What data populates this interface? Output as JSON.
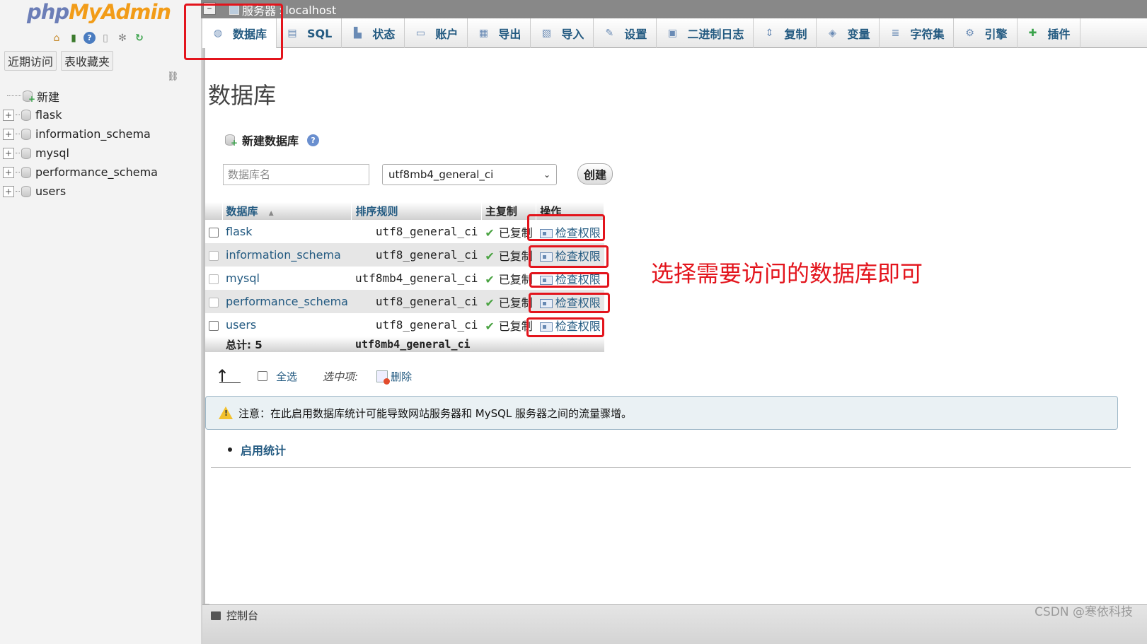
{
  "app": {
    "logo_php": "php",
    "logo_myadmin": "MyAdmin"
  },
  "colors": {
    "link": "#235a81",
    "annotation_red": "#e3141c",
    "logo_php": "#6c7eb7",
    "logo_myadmin": "#f29c18"
  },
  "sidebar": {
    "quick_icons": [
      "home-icon",
      "exit-icon",
      "help-icon",
      "docs-icon",
      "settings-icon",
      "reload-icon"
    ],
    "tabs": [
      "近期访问",
      "表收藏夹"
    ],
    "tree": [
      {
        "label": "新建",
        "icon": "new-database-icon",
        "expandable": false
      },
      {
        "label": "flask",
        "icon": "database-icon",
        "expandable": true
      },
      {
        "label": "information_schema",
        "icon": "database-icon",
        "expandable": true
      },
      {
        "label": "mysql",
        "icon": "database-icon",
        "expandable": true
      },
      {
        "label": "performance_schema",
        "icon": "database-icon",
        "expandable": true
      },
      {
        "label": "users",
        "icon": "database-icon",
        "expandable": true
      }
    ]
  },
  "topbar": {
    "server_label": "服务器",
    "server_name": "localhost"
  },
  "tabs": [
    {
      "label": "数据库",
      "icon": "database-icon",
      "active": true
    },
    {
      "label": "SQL",
      "icon": "sql-icon"
    },
    {
      "label": "状态",
      "icon": "status-icon"
    },
    {
      "label": "账户",
      "icon": "accounts-icon"
    },
    {
      "label": "导出",
      "icon": "export-icon"
    },
    {
      "label": "导入",
      "icon": "import-icon"
    },
    {
      "label": "设置",
      "icon": "wrench-icon"
    },
    {
      "label": "二进制日志",
      "icon": "binlog-icon"
    },
    {
      "label": "复制",
      "icon": "replication-icon"
    },
    {
      "label": "变量",
      "icon": "variables-icon"
    },
    {
      "label": "字符集",
      "icon": "charset-icon"
    },
    {
      "label": "引擎",
      "icon": "engine-icon"
    },
    {
      "label": "插件",
      "icon": "plugin-icon"
    }
  ],
  "main": {
    "title": "数据库",
    "create": {
      "heading": "新建数据库",
      "name_placeholder": "数据库名",
      "collation_value": "utf8mb4_general_ci",
      "create_label": "创建"
    },
    "table": {
      "headers": {
        "database": "数据库",
        "collation": "排序规则",
        "replication": "主复制",
        "action": "操作"
      },
      "sort_indicator": "▲",
      "rows": [
        {
          "name": "flask",
          "collation": "utf8_general_ci",
          "replication": "已复制",
          "action": "检查权限"
        },
        {
          "name": "information_schema",
          "collation": "utf8_general_ci",
          "replication": "已复制",
          "action": "检查权限"
        },
        {
          "name": "mysql",
          "collation": "utf8mb4_general_ci",
          "replication": "已复制",
          "action": "检查权限"
        },
        {
          "name": "performance_schema",
          "collation": "utf8_general_ci",
          "replication": "已复制",
          "action": "检查权限"
        },
        {
          "name": "users",
          "collation": "utf8_general_ci",
          "replication": "已复制",
          "action": "检查权限"
        }
      ],
      "total_label": "总计: 5",
      "total_collation": "utf8mb4_general_ci"
    },
    "bulk": {
      "select_all": "全选",
      "with_selected": "选中项:",
      "delete": "删除"
    },
    "notice": "注意：在此启用数据库统计可能导致网站服务器和 MySQL 服务器之间的流量骤增。",
    "enable_stats": "启用统计"
  },
  "annotation": "选择需要访问的数据库即可",
  "console": {
    "label": "控制台"
  },
  "watermark": "CSDN @寒依科技"
}
